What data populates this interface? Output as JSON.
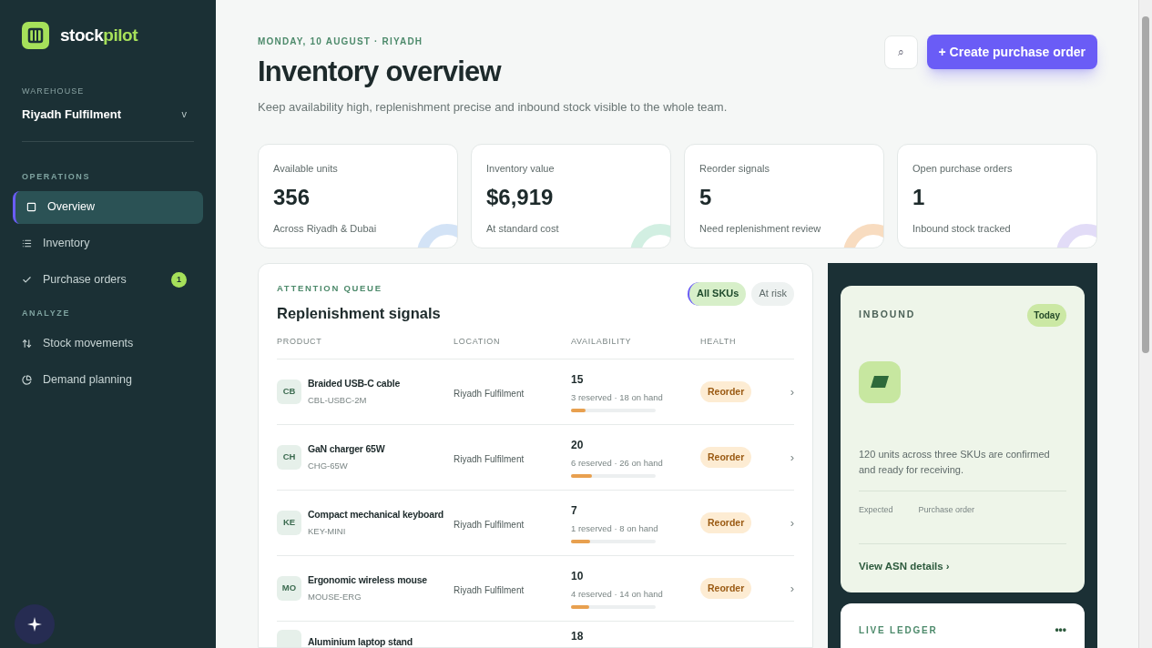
{
  "brand": {
    "part_1": "stock",
    "part_2": "pilot"
  },
  "warehouse": {
    "label": "WAREHOUSE",
    "value": "Riyadh Fulfilment",
    "caret": "v"
  },
  "nav_sections": [
    {
      "title": "OPERATIONS",
      "items": [
        {
          "label": "Overview",
          "selected": true
        },
        {
          "label": "Inventory",
          "selected": false
        },
        {
          "label": "Purchase orders",
          "selected": false,
          "badge": "1"
        }
      ]
    },
    {
      "title": "ANALYZE",
      "items": [
        {
          "label": "Stock movements",
          "selected": false
        },
        {
          "label": "Demand planning",
          "selected": false
        }
      ]
    }
  ],
  "header": {
    "eyebrow": "MONDAY, 10 AUGUST · RIYADH",
    "title": "Inventory overview",
    "subtitle": "Keep availability high, replenishment precise and inbound stock visible to the whole team.",
    "search_glyph": "⌕",
    "primary_button": "+ Create purchase order"
  },
  "kpis": [
    {
      "label": "Available units",
      "value": "356",
      "note": "Across Riyadh & Dubai",
      "color": "#d3e3f6"
    },
    {
      "label": "Inventory value",
      "value": "$6,919",
      "note": "At standard cost",
      "color": "#d2efe2"
    },
    {
      "label": "Reorder signals",
      "value": "5",
      "note": "Need replenishment review",
      "color": "#f8dcc0"
    },
    {
      "label": "Open purchase orders",
      "value": "1",
      "note": "Inbound stock tracked",
      "color": "#e2dcf7"
    }
  ],
  "queue": {
    "eyebrow": "ATTENTION QUEUE",
    "title": "Replenishment signals",
    "filters": [
      {
        "label": "All SKUs",
        "selected": true
      },
      {
        "label": "At risk",
        "selected": false
      }
    ],
    "columns": [
      "PRODUCT",
      "LOCATION",
      "AVAILABILITY",
      "HEALTH"
    ],
    "rows": [
      {
        "initials": "CB",
        "name": "Braided USB-C cable",
        "sku": "CBL-USBC-2M",
        "location": "Riyadh Fulfilment",
        "available": "15",
        "detail": "3 reserved · 18 on hand",
        "level": 0.17,
        "health": "Reorder",
        "chevron": "›"
      },
      {
        "initials": "CH",
        "name": "GaN charger 65W",
        "sku": "CHG-65W",
        "location": "Riyadh Fulfilment",
        "available": "20",
        "detail": "6 reserved · 26 on hand",
        "level": 0.25,
        "health": "Reorder",
        "chevron": "›"
      },
      {
        "initials": "KE",
        "name": "Compact mechanical keyboard",
        "sku": "KEY-MINI",
        "location": "Riyadh Fulfilment",
        "available": "7",
        "detail": "1 reserved · 8 on hand",
        "level": 0.23,
        "health": "Reorder",
        "chevron": "›"
      },
      {
        "initials": "MO",
        "name": "Ergonomic wireless mouse",
        "sku": "MOUSE-ERG",
        "location": "Riyadh Fulfilment",
        "available": "10",
        "detail": "4 reserved · 14 on hand",
        "level": 0.21,
        "health": "Reorder",
        "chevron": "›"
      },
      {
        "name": "Aluminium laptop stand",
        "available": "18"
      }
    ]
  },
  "inbound": {
    "eyebrow": "INBOUND",
    "badge": "Today",
    "text": "120 units across three SKUs are confirmed and ready for receiving.",
    "meta": [
      "Expected",
      "Purchase order"
    ],
    "link": "View ASN details ›"
  },
  "ledger": {
    "eyebrow": "LIVE LEDGER",
    "menu": "•••"
  }
}
